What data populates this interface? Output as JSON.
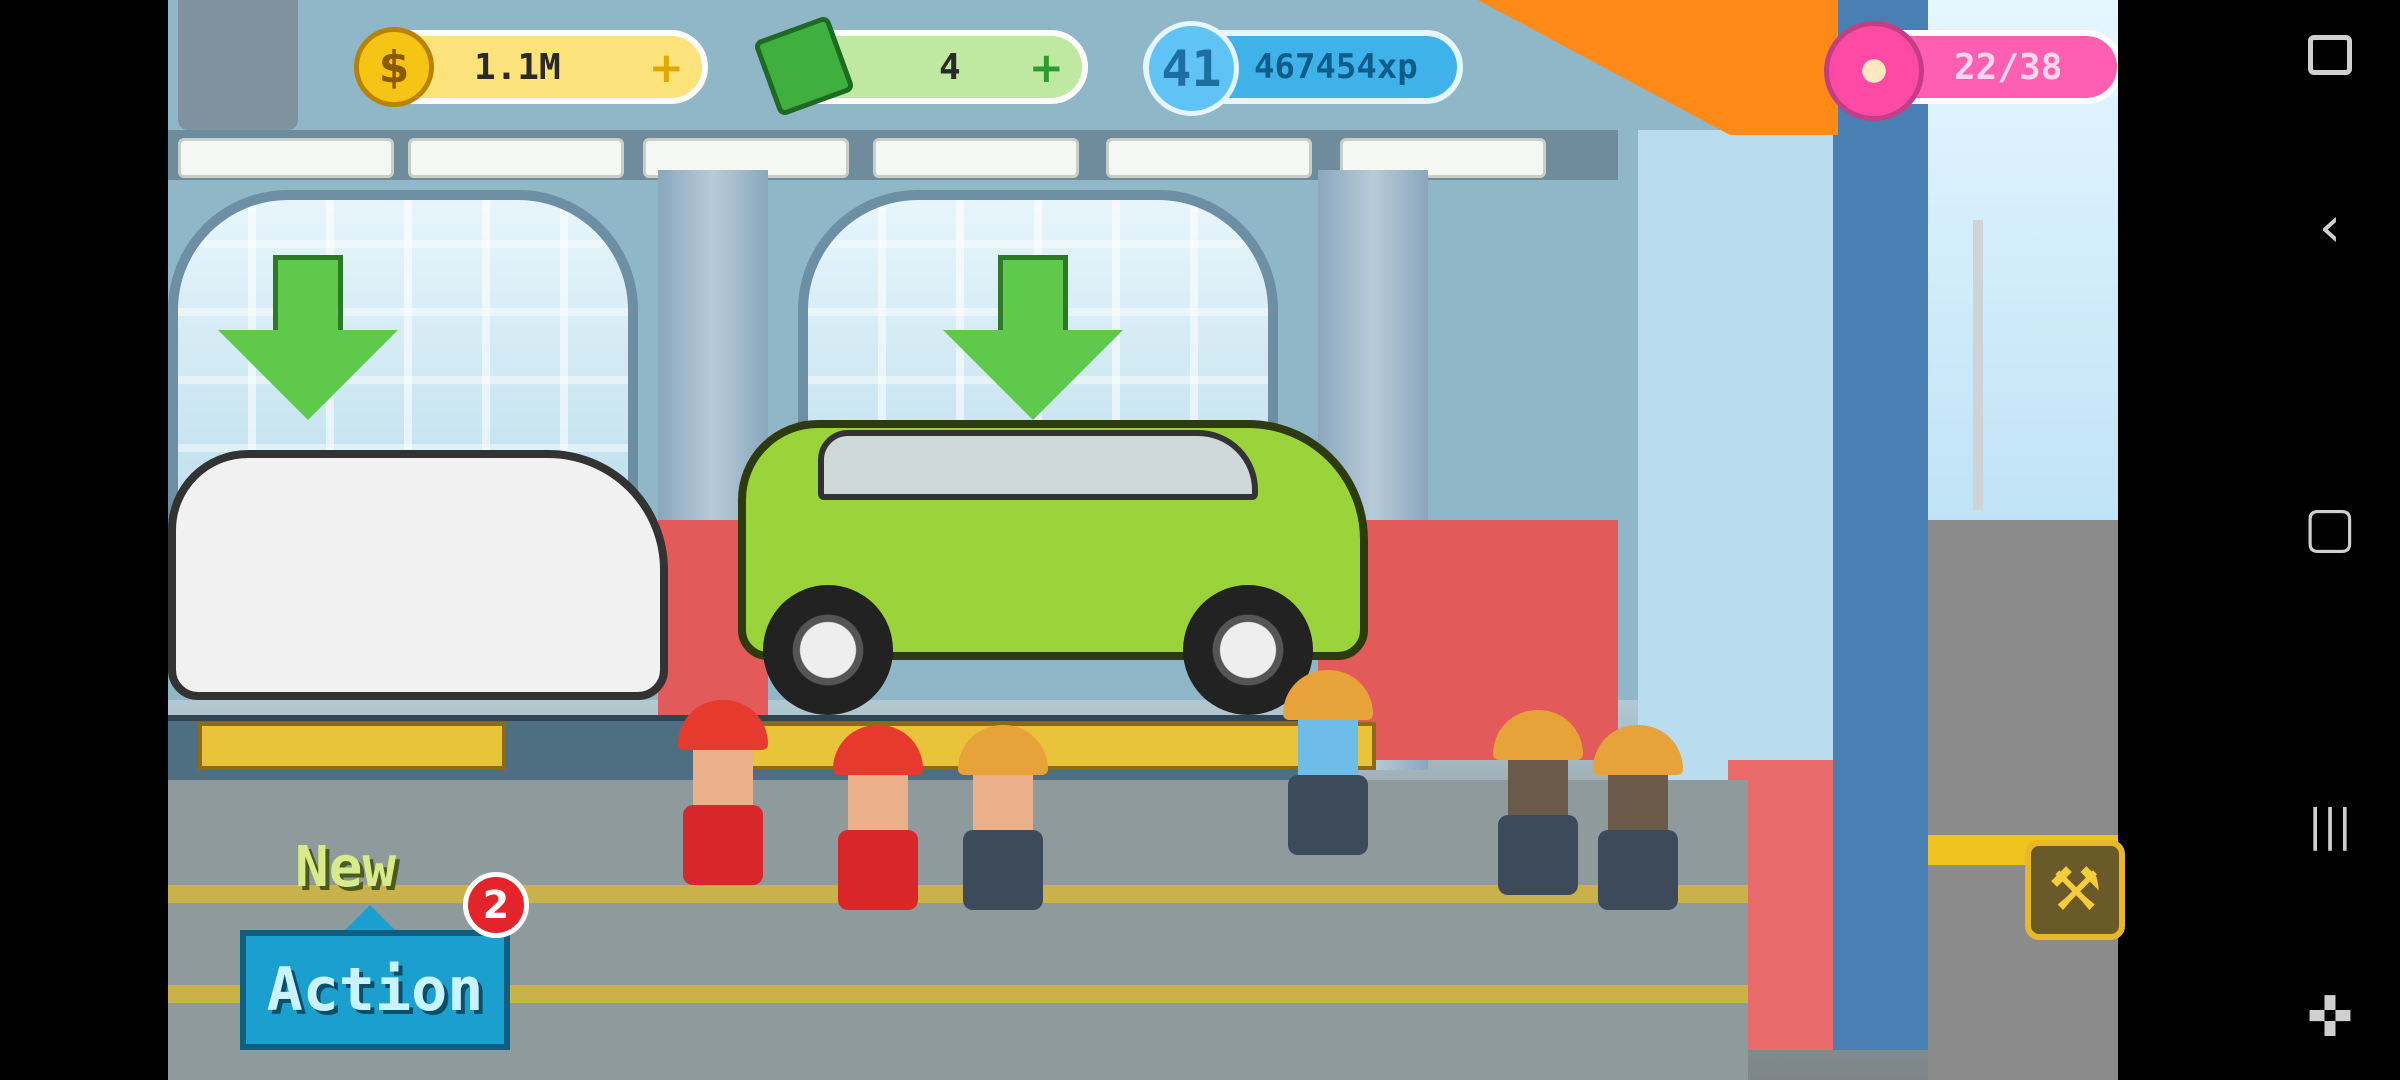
{
  "hud": {
    "coins": "1.1M",
    "cash": "4",
    "level": "41",
    "xp": "467454xp",
    "donuts": "22/38",
    "coin_plus": "+",
    "cash_plus": "+",
    "coin_symbol": "$"
  },
  "action": {
    "new_label": "New",
    "button_label": "Action",
    "badge_count": "2"
  },
  "icons": {
    "wrench": "wrench-icon",
    "nav_screenshot": "screenshot-edit-icon",
    "nav_back": "back-icon",
    "nav_home": "home-icon",
    "nav_recents": "recents-icon",
    "nav_game": "gamepad-icon"
  },
  "colors": {
    "coin_pill": "#fbe27a",
    "cash_pill": "#bfe8a0",
    "xp_pill": "#3fb2ea",
    "donut_pill": "#ff5fb0",
    "action_button": "#1a9fcf"
  },
  "navbar": {
    "back": "‹",
    "home": "▢",
    "recents": "|||",
    "game": "✜"
  }
}
